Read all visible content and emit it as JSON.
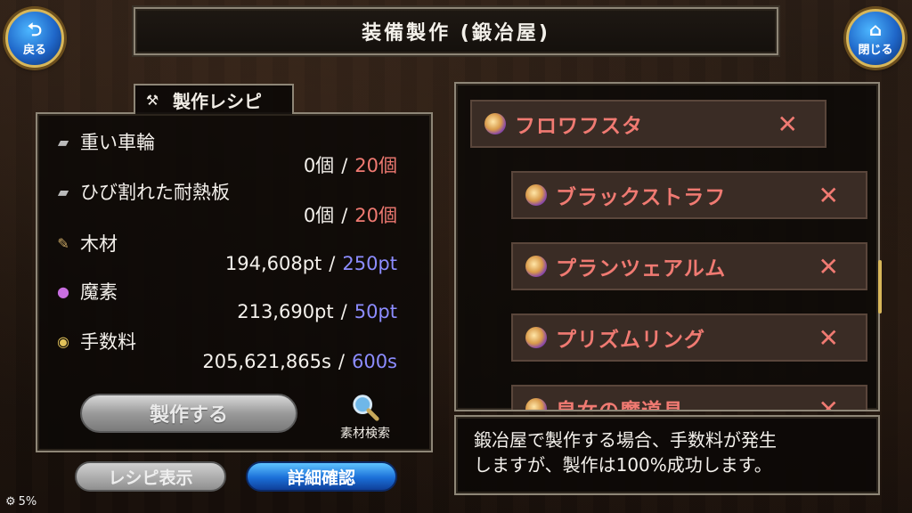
{
  "header": {
    "title": "装備製作 (鍛冶屋)",
    "back_label": "戻る",
    "close_label": "閉じる"
  },
  "recipe_panel": {
    "tab_label": "製作レシピ",
    "materials": [
      {
        "name": "重い車輪",
        "icon": "metal-plate-icon",
        "have": "0個",
        "need": "20個",
        "need_color": "red"
      },
      {
        "name": "ひび割れた耐熱板",
        "icon": "metal-plate-icon",
        "have": "0個",
        "need": "20個",
        "need_color": "red"
      },
      {
        "name": "木材",
        "icon": "wood-icon",
        "have": "194,608pt",
        "need": "250pt",
        "need_color": "blue"
      },
      {
        "name": "魔素",
        "icon": "magic-orb-icon",
        "have": "213,690pt",
        "need": "50pt",
        "need_color": "blue"
      },
      {
        "name": "手数料",
        "icon": "coin-icon",
        "have": "205,621,865s",
        "need": "600s",
        "need_color": "blue"
      }
    ],
    "make_button": "製作する",
    "search_button": "素材検索",
    "recipe_show_button": "レシピ表示",
    "detail_button": "詳細確認",
    "progress_label": "5%"
  },
  "tree": {
    "items": [
      {
        "name": "フロワフスタ",
        "level": 0
      },
      {
        "name": "ブラックストラフ",
        "level": 1
      },
      {
        "name": "プランツェアルム",
        "level": 1
      },
      {
        "name": "プリズムリング",
        "level": 1
      },
      {
        "name": "皇女の魔道具",
        "level": 1
      }
    ]
  },
  "message": {
    "line1": "鍛冶屋で製作する場合、手数料が発生",
    "line2": "しますが、製作は100%成功します。"
  },
  "colors": {
    "accent_red": "#f07a72",
    "accent_blue": "#8c8cff",
    "frame": "#8e8677"
  }
}
